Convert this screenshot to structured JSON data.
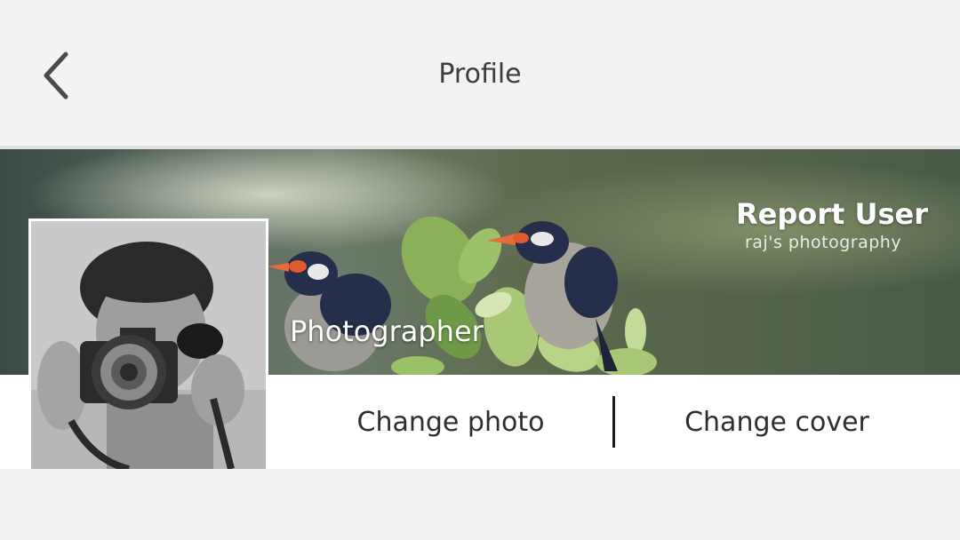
{
  "header": {
    "title": "Profile",
    "back_icon": "chevron-left-icon"
  },
  "profile": {
    "report_label": "Report User",
    "watermark": "raj's photography",
    "occupation": "Photographer"
  },
  "actions": {
    "change_photo_label": "Change photo",
    "change_cover_label": "Change cover"
  },
  "colors": {
    "header_bg": "#f3f3f3",
    "page_bg": "#f2f2f2",
    "text": "#3d3d3d"
  }
}
